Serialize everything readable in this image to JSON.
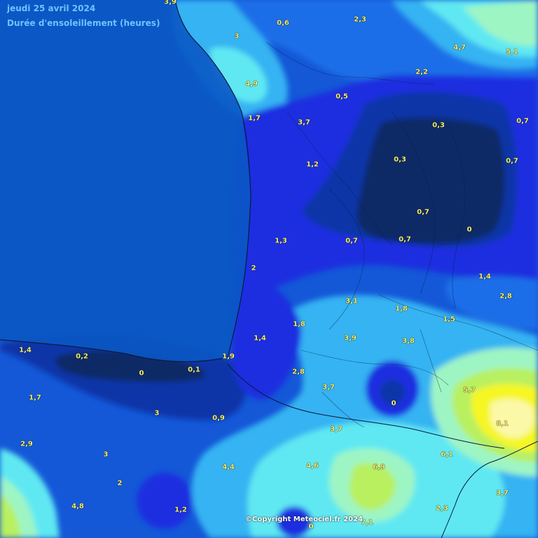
{
  "header": {
    "date": "jeudi 25 avril 2024",
    "parameter": "Durée d'ensoleillement (heures)"
  },
  "copyright": "©Copyright Meteociel.fr 2024",
  "colors": {
    "sea": "#0a58c4",
    "very_low": "#0a2a66",
    "low": "#0c36a8",
    "mid_low": "#1a2fe0",
    "mid": "#1f6ee8",
    "mid_high": "#36b3f2",
    "cyan": "#5ee8f2",
    "light": "#9ef5c4",
    "green": "#b8f060",
    "yellow": "#f6f624",
    "bright": "#fbf8a8"
  },
  "values": [
    {
      "label": "3,9"
    },
    {
      "label": "0,6"
    },
    {
      "label": "2,3"
    },
    {
      "label": "3"
    },
    {
      "label": "4,7"
    },
    {
      "label": "5,1"
    },
    {
      "label": "4,9"
    },
    {
      "label": "2,2"
    },
    {
      "label": "0,5"
    },
    {
      "label": "1,7"
    },
    {
      "label": "3,7"
    },
    {
      "label": "0,3"
    },
    {
      "label": "0,7"
    },
    {
      "label": "1,2"
    },
    {
      "label": "0,3"
    },
    {
      "label": "0,7"
    },
    {
      "label": "0,7"
    },
    {
      "label": "0"
    },
    {
      "label": "1,3"
    },
    {
      "label": "0,7"
    },
    {
      "label": "0,7"
    },
    {
      "label": "2"
    },
    {
      "label": "1,4"
    },
    {
      "label": "2,8"
    },
    {
      "label": "3,1"
    },
    {
      "label": "1,8"
    },
    {
      "label": "1,5"
    },
    {
      "label": "1,8"
    },
    {
      "label": "1,4"
    },
    {
      "label": "3,9"
    },
    {
      "label": "3,8"
    },
    {
      "label": "1,4"
    },
    {
      "label": "0,2"
    },
    {
      "label": "0"
    },
    {
      "label": "0,1"
    },
    {
      "label": "1,9"
    },
    {
      "label": "2,8"
    },
    {
      "label": "3,7"
    },
    {
      "label": "5,7"
    },
    {
      "label": "1,7"
    },
    {
      "label": "0"
    },
    {
      "label": "3"
    },
    {
      "label": "0,9"
    },
    {
      "label": "3,7"
    },
    {
      "label": "8,1"
    },
    {
      "label": "2,9"
    },
    {
      "label": "3"
    },
    {
      "label": "6,1"
    },
    {
      "label": "4,4"
    },
    {
      "label": "4,6"
    },
    {
      "label": "6,9"
    },
    {
      "label": "2"
    },
    {
      "label": "3,7"
    },
    {
      "label": "4,8"
    },
    {
      "label": "1,2"
    },
    {
      "label": "2,3"
    },
    {
      "label": "0"
    },
    {
      "label": "7,1"
    }
  ]
}
